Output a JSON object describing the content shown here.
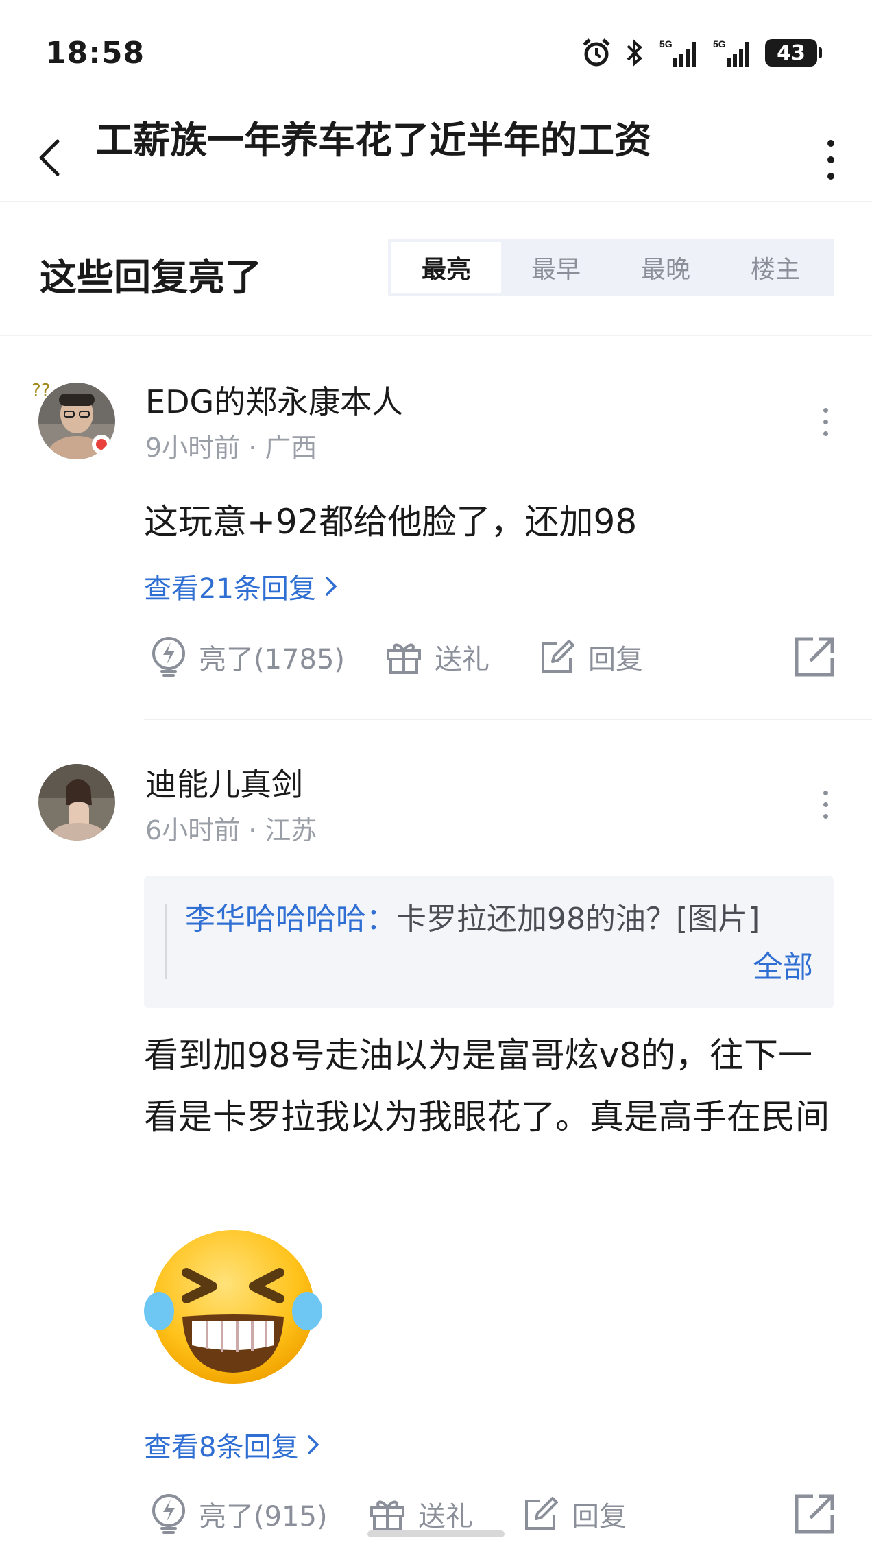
{
  "status_bar": {
    "time": "18:58",
    "battery": "43",
    "network_1": "5G",
    "network_2": "5G"
  },
  "nav": {
    "title": "工薪族一年养车花了近半年的工资"
  },
  "section": {
    "title": "这些回复亮了",
    "sort_tabs": [
      "最亮",
      "最早",
      "最晚",
      "楼主"
    ],
    "active_tab": "最亮"
  },
  "comments": [
    {
      "username": "EDG的郑永康本人",
      "time": "9小时前",
      "location": "广西",
      "meta": "9小时前 · 广西",
      "content": "这玩意+92都给他脸了，还加98",
      "view_replies": "查看21条回复",
      "like_label": "亮了(1785)",
      "gift_label": "送礼",
      "reply_label": "回复"
    },
    {
      "username": "迪能儿真剑",
      "time": "6小时前",
      "location": "江苏",
      "meta": "6小时前 · 江苏",
      "quote_author": "李华哈哈哈哈：",
      "quote_text": "卡罗拉还加98的油？[图片]",
      "quote_more": "全部",
      "content": "看到加98号走油以为是富哥炫v8的，往下一看是卡罗拉我以为我眼花了。真是高手在民间",
      "view_replies": "查看8条回复",
      "like_label": "亮了(915)",
      "gift_label": "送礼",
      "reply_label": "回复"
    }
  ],
  "colors": {
    "link": "#2f6fd3",
    "muted": "#8a8f99",
    "tab_bg": "#eef1f8"
  }
}
